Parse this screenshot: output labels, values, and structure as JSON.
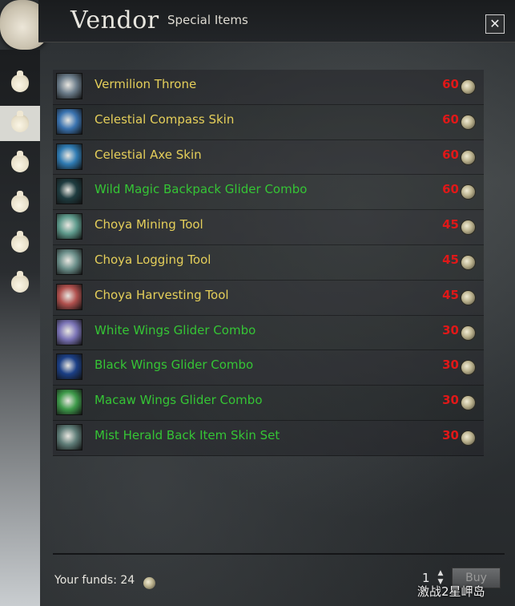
{
  "header": {
    "title": "Vendor",
    "subtitle": "Special Items",
    "close_label": "✕"
  },
  "sidebar": {
    "tabs": [
      {
        "icon": "bag-icon",
        "active": false
      },
      {
        "icon": "bag-icon",
        "active": true
      },
      {
        "icon": "bag-icon",
        "active": false
      },
      {
        "icon": "bag-icon",
        "active": false
      },
      {
        "icon": "bag-icon",
        "active": false
      },
      {
        "icon": "bag-icon",
        "active": false
      }
    ]
  },
  "items": [
    {
      "name": "Vermilion Throne",
      "price": "60",
      "name_color": "#e5cf5a",
      "icon_color": "#6b7c8a"
    },
    {
      "name": "Celestial Compass Skin",
      "price": "60",
      "name_color": "#e5cf5a",
      "icon_color": "#3a73b0"
    },
    {
      "name": "Celestial Axe Skin",
      "price": "60",
      "name_color": "#e5cf5a",
      "icon_color": "#2f7bb3"
    },
    {
      "name": "Wild Magic Backpack Glider Combo",
      "price": "60",
      "name_color": "#35c535",
      "icon_color": "#1f3c40"
    },
    {
      "name": "Choya Mining Tool",
      "price": "45",
      "name_color": "#e5cf5a",
      "icon_color": "#5e9a8c"
    },
    {
      "name": "Choya Logging Tool",
      "price": "45",
      "name_color": "#e5cf5a",
      "icon_color": "#6b8f8a"
    },
    {
      "name": "Choya Harvesting Tool",
      "price": "45",
      "name_color": "#e5cf5a",
      "icon_color": "#b0504d"
    },
    {
      "name": "White Wings Glider Combo",
      "price": "30",
      "name_color": "#35c535",
      "icon_color": "#7a73b6"
    },
    {
      "name": "Black Wings Glider Combo",
      "price": "30",
      "name_color": "#35c535",
      "icon_color": "#1b3f86"
    },
    {
      "name": "Macaw Wings Glider Combo",
      "price": "30",
      "name_color": "#35c535",
      "icon_color": "#3e9a4a"
    },
    {
      "name": "Mist Herald Back Item Skin Set",
      "price": "30",
      "name_color": "#35c535",
      "icon_color": "#5f7d78"
    }
  ],
  "footer": {
    "funds_label": "Your funds: 24",
    "quantity": "1",
    "buy_label": "Buy"
  },
  "watermark": "激战2星岬岛",
  "colors": {
    "price": "#e01818",
    "rare_item": "#e5cf5a",
    "special_item": "#35c535"
  }
}
